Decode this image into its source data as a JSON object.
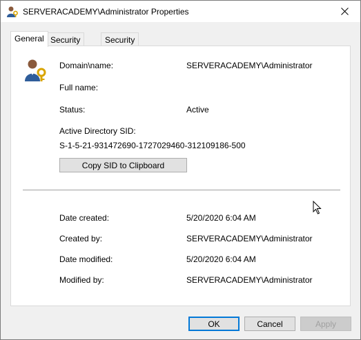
{
  "window": {
    "title": "SERVERACADEMY\\Administrator Properties"
  },
  "tabs": [
    {
      "label": "General",
      "active": true
    },
    {
      "label": "Security Roles",
      "active": false
    },
    {
      "label": "Security Scopes",
      "active": false
    }
  ],
  "general": {
    "domain_name_label": "Domain\\name:",
    "domain_name_value": "SERVERACADEMY\\Administrator",
    "full_name_label": "Full name:",
    "full_name_value": "",
    "status_label": "Status:",
    "status_value": "Active",
    "sid_label": "Active Directory SID:",
    "sid_value": "S-1-5-21-931472690-1727029460-312109186-500",
    "copy_sid_button": "Copy SID to Clipboard",
    "date_created_label": "Date created:",
    "date_created_value": "5/20/2020 6:04 AM",
    "created_by_label": "Created by:",
    "created_by_value": "SERVERACADEMY\\Administrator",
    "date_modified_label": "Date modified:",
    "date_modified_value": "5/20/2020 6:04 AM",
    "modified_by_label": "Modified by:",
    "modified_by_value": "SERVERACADEMY\\Administrator"
  },
  "footer": {
    "ok": "OK",
    "cancel": "Cancel",
    "apply": "Apply"
  },
  "icons": {
    "title": "user-key-icon",
    "user": "user-key-icon",
    "close": "close-icon",
    "cursor": "mouse-cursor-icon"
  }
}
